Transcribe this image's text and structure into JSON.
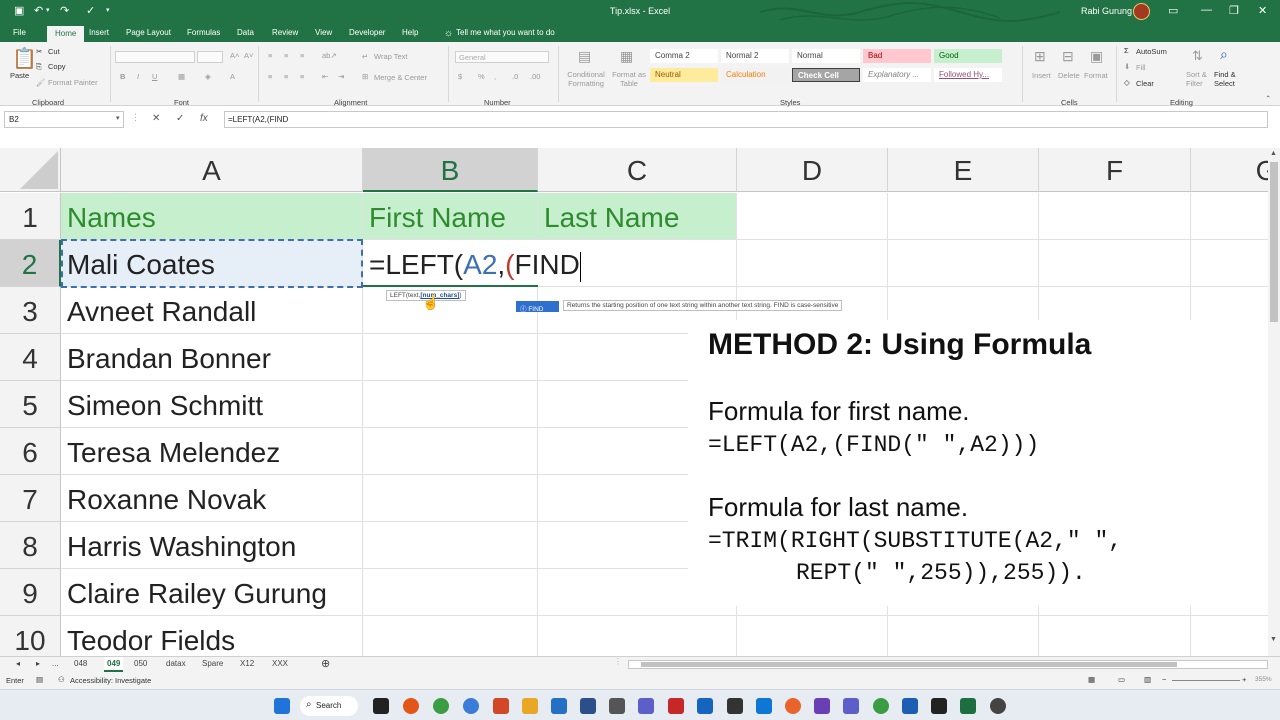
{
  "titlebar": {
    "document": "Tip.xlsx - Excel",
    "user": "Rabi Gurung"
  },
  "tabs": [
    "File",
    "Home",
    "Insert",
    "Page Layout",
    "Formulas",
    "Data",
    "Review",
    "View",
    "Developer",
    "Help"
  ],
  "tell_me": "Tell me what you want to do",
  "ribbon": {
    "clipboard": {
      "paste": "Paste",
      "cut": "Cut",
      "copy": "Copy",
      "format_painter": "Format Painter",
      "label": "Clipboard"
    },
    "font_label": "Font",
    "alignment": {
      "wrap": "Wrap Text",
      "merge": "Merge & Center",
      "label": "Alignment"
    },
    "number": {
      "format": "General",
      "label": "Number"
    },
    "styles": {
      "conditional": "Conditional Formatting",
      "format_as_table": "Format as Table",
      "cells": [
        {
          "name": "Comma 2",
          "bg": "#ffffff",
          "color": "#444444"
        },
        {
          "name": "Normal 2",
          "bg": "#ffffff",
          "color": "#444444"
        },
        {
          "name": "Normal",
          "bg": "#ffffff",
          "color": "#444444"
        },
        {
          "name": "Bad",
          "bg": "#ffc7ce",
          "color": "#9c0006"
        },
        {
          "name": "Good",
          "bg": "#c6efce",
          "color": "#006100"
        },
        {
          "name": "Neutral",
          "bg": "#ffeb9c",
          "color": "#9c5700"
        },
        {
          "name": "Calculation",
          "bg": "#f2f2f2",
          "color": "#fa7d00"
        },
        {
          "name": "Check Cell",
          "bg": "#a5a5a5",
          "color": "#ffffff"
        },
        {
          "name": "Explanatory ...",
          "bg": "#ffffff",
          "color": "#7f7f7f"
        },
        {
          "name": "Followed Hy...",
          "bg": "#ffffff",
          "color": "#954f72"
        }
      ],
      "label": "Styles"
    },
    "cells": {
      "insert": "Insert",
      "delete": "Delete",
      "format": "Format",
      "label": "Cells"
    },
    "editing": {
      "autosum": "AutoSum",
      "fill": "Fill",
      "clear": "Clear",
      "sort": "Sort & Filter",
      "find": "Find & Select",
      "label": "Editing"
    }
  },
  "formula_bar": {
    "name_box": "B2",
    "formula": "=LEFT(A2,(FIND"
  },
  "columns": [
    "A",
    "B",
    "C",
    "D",
    "E",
    "F",
    "G"
  ],
  "rows": [
    "1",
    "2",
    "3",
    "4",
    "5",
    "6",
    "7",
    "8",
    "9",
    "10"
  ],
  "cells": {
    "a": [
      "Names",
      "Mali Coates",
      "Avneet Randall",
      "Brandan Bonner",
      "Simeon Schmitt",
      "Teresa Melendez",
      "Roxanne Novak",
      "Harris Washington",
      "Claire Railey Gurung",
      "Teodor Fields"
    ],
    "b1": "First Name",
    "c1": "Last Name",
    "b2_edit_prefix": "=LEFT(",
    "b2_edit_ref": "A2",
    "b2_edit_comma": ",",
    "b2_edit_paren": "(",
    "b2_edit_func": "FIND"
  },
  "tooltips": {
    "args_fn": "LEFT(text,",
    "args_active": "[num_chars]",
    "args_close": ")",
    "find_chip": "FIND",
    "find_desc": "Returns the starting position of one text string within another text string. FIND is case-sensitive"
  },
  "method": {
    "title": "METHOD 2: Using Formula",
    "first_label": "Formula for first name.",
    "first_formula": "=LEFT(A2,(FIND(\" \",A2)))",
    "last_label": "Formula for last name.",
    "last_formula_1": "=TRIM(RIGHT(SUBSTITUTE(A2,\" \",",
    "last_formula_2": "REPT(\" \",255)),255)).",
    "accent": "#217346"
  },
  "sheet_tabs": [
    "...",
    "048",
    "049",
    "050",
    "datax",
    "Spare",
    "X12",
    "XXX"
  ],
  "active_sheet": "049",
  "status": {
    "mode": "Enter",
    "accessibility": "Accessibility: Investigate",
    "zoom": "355%"
  },
  "taskbar": {
    "search": "Search"
  }
}
